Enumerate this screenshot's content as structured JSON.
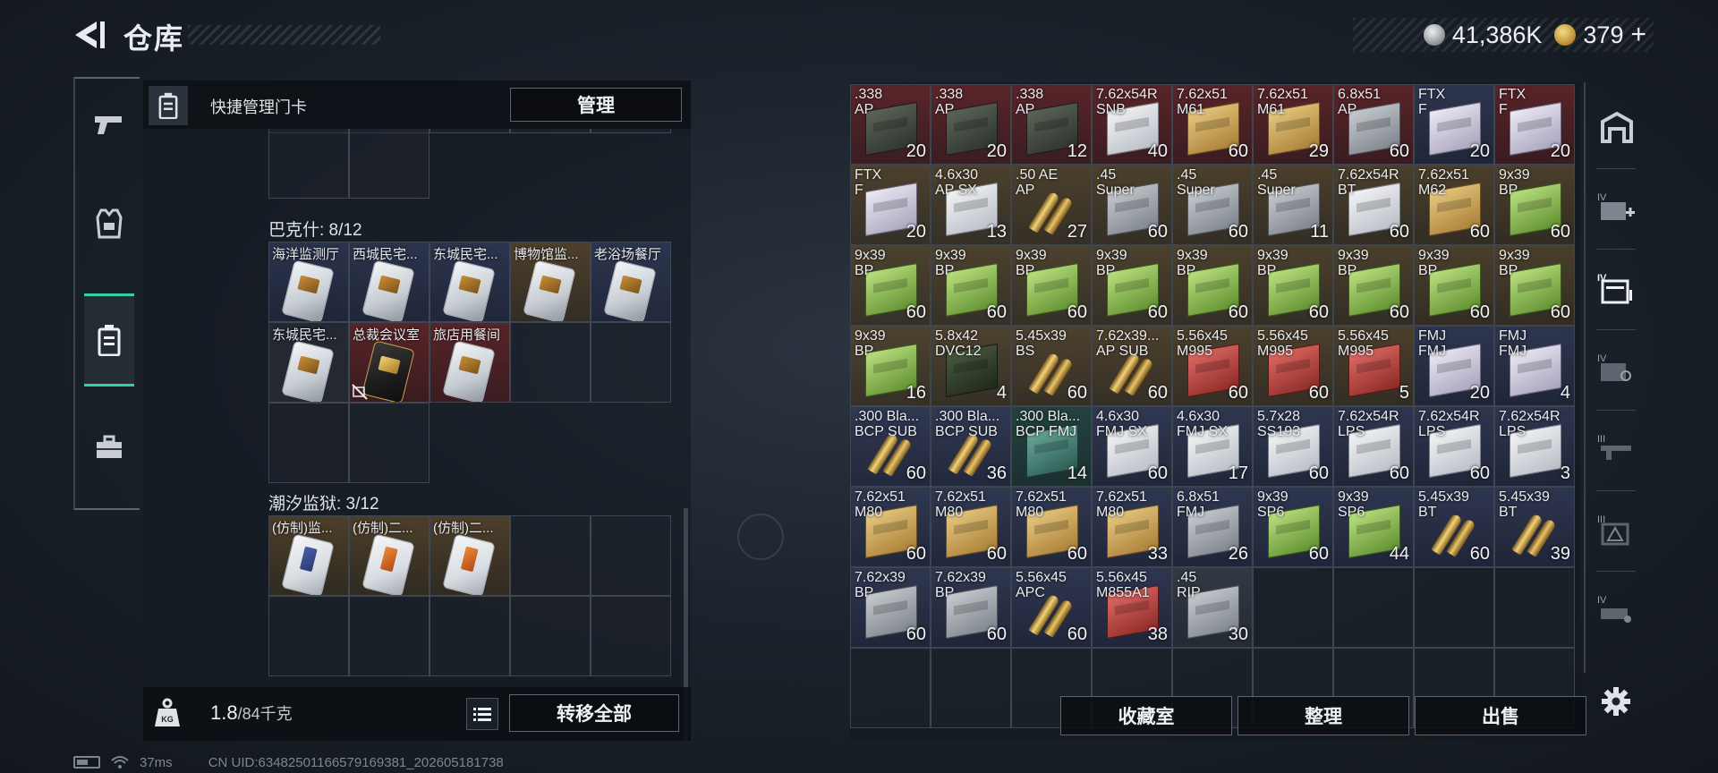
{
  "header": {
    "title": "仓库",
    "currency_silver": "41,386K",
    "currency_gold": "379",
    "plus_label": "+"
  },
  "left_panel": {
    "header_title": "快捷管理门卡",
    "manage_label": "管理",
    "section_bakesh": "巴克什: 8/12",
    "section_chaoxi": "潮汐监狱: 3/12",
    "bakesh_cards": [
      {
        "name": "海洋监测厅",
        "quality": "q-blue",
        "card": "normal"
      },
      {
        "name": "西城民宅...",
        "quality": "q-blue",
        "card": "normal"
      },
      {
        "name": "东城民宅...",
        "quality": "q-blue",
        "card": "normal"
      },
      {
        "name": "博物馆监...",
        "quality": "q-gold",
        "card": "normal"
      },
      {
        "name": "老浴场餐厅",
        "quality": "q-blue",
        "card": "normal"
      },
      {
        "name": "东城民宅...",
        "quality": "q-dark",
        "card": "normal"
      },
      {
        "name": "总裁会议室",
        "quality": "q-red",
        "card": "dark"
      },
      {
        "name": "旅店用餐间",
        "quality": "q-red",
        "card": "normal"
      }
    ],
    "chaoxi_cards": [
      {
        "name": "(仿制)监...",
        "quality": "q-gold",
        "card": "fake"
      },
      {
        "name": "(仿制)二...",
        "quality": "q-gold",
        "card": "fake orange"
      },
      {
        "name": "(仿制)二...",
        "quality": "q-gold",
        "card": "fake orange"
      }
    ],
    "weight_value": "1.8",
    "weight_capacity": "/84千克",
    "transfer_all_label": "转移全部"
  },
  "ammo_grid": [
    {
      "name": ".338\nAP",
      "count": "20",
      "color": "c-red",
      "box": "t-military"
    },
    {
      "name": ".338\nAP",
      "count": "20",
      "color": "c-red",
      "box": "t-military"
    },
    {
      "name": ".338\nAP",
      "count": "12",
      "color": "c-red",
      "box": "t-military"
    },
    {
      "name": "7.62x54R\nSNB",
      "count": "40",
      "color": "c-red",
      "box": "t-white"
    },
    {
      "name": "7.62x51\nM61",
      "count": "60",
      "color": "c-red",
      "box": "t-tan"
    },
    {
      "name": "7.62x51\nM61",
      "count": "29",
      "color": "c-red",
      "box": "t-tan"
    },
    {
      "name": "6.8x51\nAP",
      "count": "60",
      "color": "c-red",
      "box": "t-gray"
    },
    {
      "name": "FTX\nF",
      "count": "20",
      "color": "c-blue",
      "box": "t-lilac"
    },
    {
      "name": "FTX\nF",
      "count": "20",
      "color": "c-red",
      "box": "t-lilac"
    },
    {
      "name": "FTX\nF",
      "count": "20",
      "color": "c-gold",
      "box": "t-lilac"
    },
    {
      "name": "4.6x30\nAP SX",
      "count": "13",
      "color": "c-gold",
      "box": "t-white"
    },
    {
      "name": ".50 AE\nAP",
      "count": "27",
      "color": "c-gold",
      "box": "t-bullets"
    },
    {
      "name": ".45\nSuper",
      "count": "60",
      "color": "c-gold",
      "box": "t-gray"
    },
    {
      "name": ".45\nSuper",
      "count": "60",
      "color": "c-gold",
      "box": "t-gray"
    },
    {
      "name": ".45\nSuper",
      "count": "11",
      "color": "c-gold",
      "box": "t-gray"
    },
    {
      "name": "7.62x54R\nBT",
      "count": "60",
      "color": "c-gold",
      "box": "t-white"
    },
    {
      "name": "7.62x51\nM62",
      "count": "60",
      "color": "c-gold",
      "box": "t-tan"
    },
    {
      "name": "9x39\nBP",
      "count": "60",
      "color": "c-gold",
      "box": "t-green"
    },
    {
      "name": "9x39\nBP",
      "count": "60",
      "color": "c-gold",
      "box": "t-green"
    },
    {
      "name": "9x39\nBP",
      "count": "60",
      "color": "c-gold",
      "box": "t-green"
    },
    {
      "name": "9x39\nBP",
      "count": "60",
      "color": "c-gold",
      "box": "t-green"
    },
    {
      "name": "9x39\nBP",
      "count": "60",
      "color": "c-gold",
      "box": "t-green"
    },
    {
      "name": "9x39\nBP",
      "count": "60",
      "color": "c-gold",
      "box": "t-green"
    },
    {
      "name": "9x39\nBP",
      "count": "60",
      "color": "c-gold",
      "box": "t-green"
    },
    {
      "name": "9x39\nBP",
      "count": "60",
      "color": "c-gold",
      "box": "t-green"
    },
    {
      "name": "9x39\nBP",
      "count": "60",
      "color": "c-gold",
      "box": "t-green"
    },
    {
      "name": "9x39\nBP",
      "count": "60",
      "color": "c-gold",
      "box": "t-green"
    },
    {
      "name": "9x39\nBP",
      "count": "16",
      "color": "c-gold",
      "box": "t-green"
    },
    {
      "name": "5.8x42\nDVC12",
      "count": "4",
      "color": "c-gold",
      "box": "t-darkgreen"
    },
    {
      "name": "5.45x39\nBS",
      "count": "60",
      "color": "c-gold",
      "box": "t-bullets"
    },
    {
      "name": "7.62x39...\nAP SUB",
      "count": "60",
      "color": "c-gold",
      "box": "t-bullets"
    },
    {
      "name": "5.56x45\nM995",
      "count": "60",
      "color": "c-gold",
      "box": "t-redbox"
    },
    {
      "name": "5.56x45\nM995",
      "count": "60",
      "color": "c-gold",
      "box": "t-redbox"
    },
    {
      "name": "5.56x45\nM995",
      "count": "5",
      "color": "c-gold",
      "box": "t-redbox"
    },
    {
      "name": "FMJ\nFMJ",
      "count": "20",
      "color": "c-blue",
      "box": "t-lilac"
    },
    {
      "name": "FMJ\nFMJ",
      "count": "4",
      "color": "c-blue",
      "box": "t-lilac"
    },
    {
      "name": ".300 Bla...\nBCP SUB",
      "count": "60",
      "color": "c-blue",
      "box": "t-bullets"
    },
    {
      "name": ".300 Bla...\nBCP SUB",
      "count": "36",
      "color": "c-blue",
      "box": "t-bullets"
    },
    {
      "name": ".300 Bla...\nBCP FMJ",
      "count": "14",
      "color": "c-green",
      "box": "t-teal"
    },
    {
      "name": "4.6x30\nFMJ SX",
      "count": "60",
      "color": "c-blue",
      "box": "t-white"
    },
    {
      "name": "4.6x30\nFMJ SX",
      "count": "17",
      "color": "c-blue",
      "box": "t-white"
    },
    {
      "name": "5.7x28\nSS193",
      "count": "60",
      "color": "c-blue",
      "box": "t-white"
    },
    {
      "name": "7.62x54R\nLPS",
      "count": "60",
      "color": "c-blue",
      "box": "t-white"
    },
    {
      "name": "7.62x54R\nLPS",
      "count": "60",
      "color": "c-blue",
      "box": "t-white"
    },
    {
      "name": "7.62x54R\nLPS",
      "count": "3",
      "color": "c-blue",
      "box": "t-white"
    },
    {
      "name": "7.62x51\nM80",
      "count": "60",
      "color": "c-blue",
      "box": "t-tan"
    },
    {
      "name": "7.62x51\nM80",
      "count": "60",
      "color": "c-blue",
      "box": "t-tan"
    },
    {
      "name": "7.62x51\nM80",
      "count": "60",
      "color": "c-blue",
      "box": "t-tan"
    },
    {
      "name": "7.62x51\nM80",
      "count": "33",
      "color": "c-blue",
      "box": "t-tan"
    },
    {
      "name": "6.8x51\nFMJ",
      "count": "26",
      "color": "c-blue",
      "box": "t-gray"
    },
    {
      "name": "9x39\nSP6",
      "count": "60",
      "color": "c-blue",
      "box": "t-green"
    },
    {
      "name": "9x39\nSP6",
      "count": "44",
      "color": "c-blue",
      "box": "t-green"
    },
    {
      "name": "5.45x39\nBT",
      "count": "60",
      "color": "c-blue",
      "box": "t-bullets"
    },
    {
      "name": "5.45x39\nBT",
      "count": "39",
      "color": "c-blue",
      "box": "t-bullets"
    },
    {
      "name": "7.62x39\nBP",
      "count": "60",
      "color": "c-blue",
      "box": "t-gray"
    },
    {
      "name": "7.62x39\nBP",
      "count": "60",
      "color": "c-blue",
      "box": "t-gray"
    },
    {
      "name": "5.56x45\nAPC",
      "count": "60",
      "color": "c-blue",
      "box": "t-bullets"
    },
    {
      "name": "5.56x45\nM855A1",
      "count": "38",
      "color": "c-blue",
      "box": "t-redbox"
    },
    {
      "name": ".45\nRIP",
      "count": "30",
      "color": "c-gray",
      "box": "t-gray"
    }
  ],
  "bottom_buttons": {
    "collection": "收藏室",
    "organize": "整理",
    "sell": "出售"
  },
  "status_bar": {
    "ping": "37ms",
    "uid": "CN UID:6348250116657916938​1_202605181738"
  }
}
